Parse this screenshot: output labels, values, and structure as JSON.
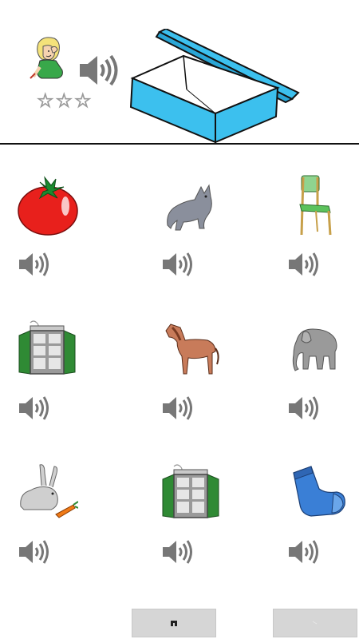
{
  "header": {
    "stars_total": 3,
    "stars_filled": 0,
    "star_glyph": "☆",
    "target_picture": "open-box"
  },
  "grid": [
    {
      "picture": "tomato"
    },
    {
      "picture": "cat"
    },
    {
      "picture": "chair"
    },
    {
      "picture": "window"
    },
    {
      "picture": "horse"
    },
    {
      "picture": "elephant"
    },
    {
      "picture": "rabbit"
    },
    {
      "picture": "window"
    },
    {
      "picture": "sock"
    }
  ],
  "footer": {
    "home_icon": "home-icon",
    "next_icon": "next-arrow-icon"
  },
  "colors": {
    "box_blue": "#3cc0ee",
    "speaker_gray": "#7a7a7a",
    "button_gray": "#d6d6d6"
  }
}
